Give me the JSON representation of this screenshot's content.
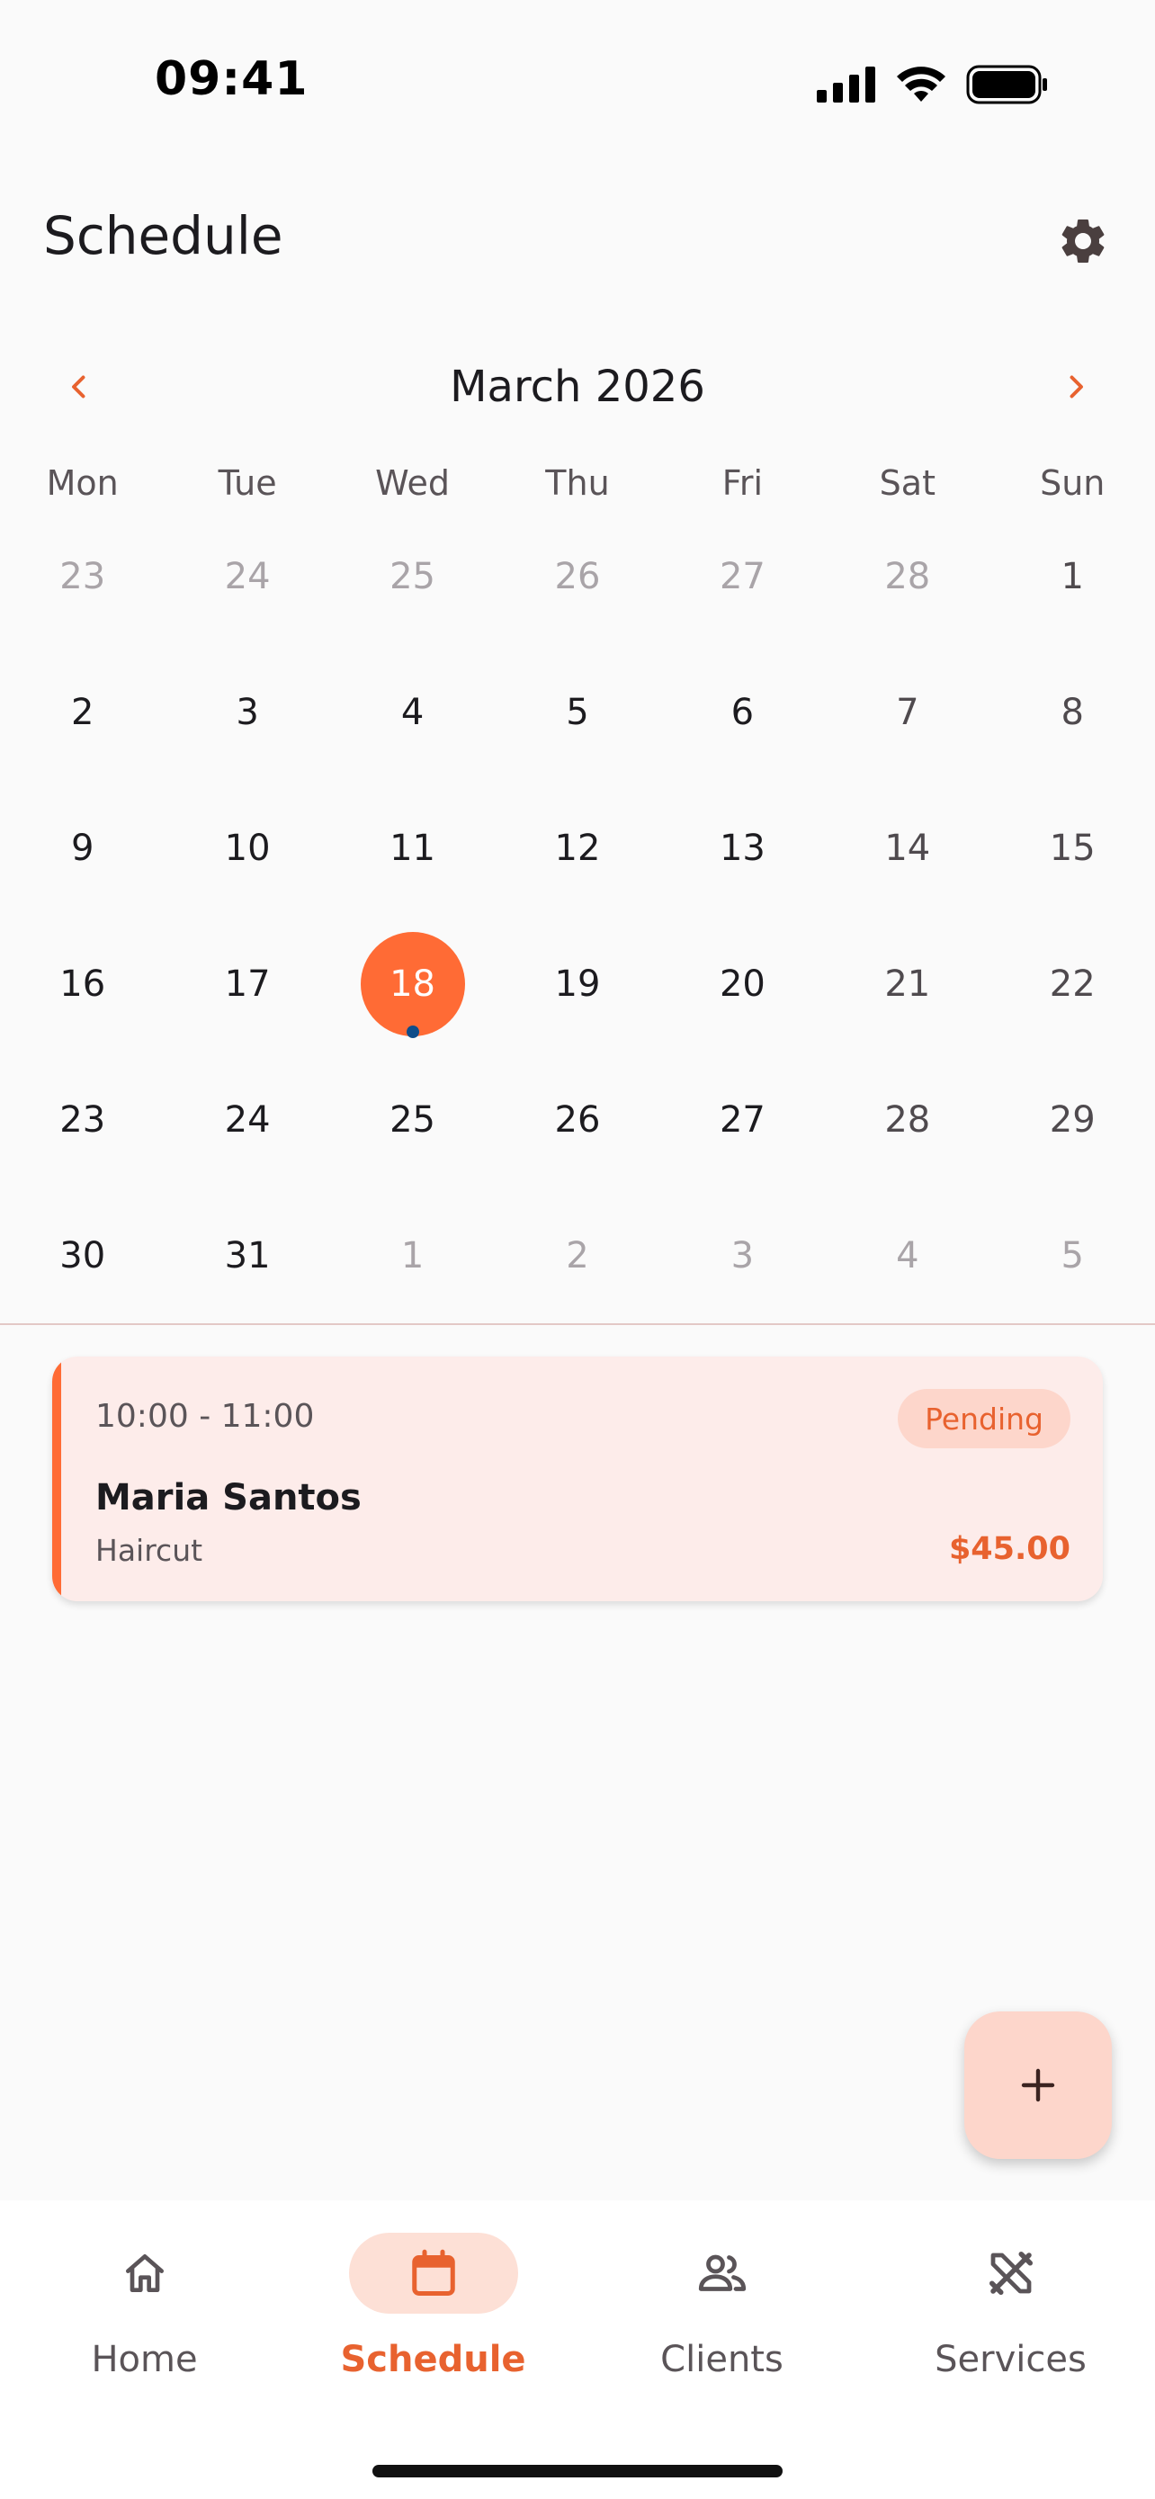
{
  "status_bar": {
    "time": "09:41"
  },
  "header": {
    "title": "Schedule",
    "settings_icon": "gear-icon"
  },
  "calendar": {
    "month_label": "March 2026",
    "weekdays": [
      "Mon",
      "Tue",
      "Wed",
      "Thu",
      "Fri",
      "Sat",
      "Sun"
    ],
    "weeks": [
      [
        "23",
        "24",
        "25",
        "26",
        "27",
        "28",
        "1"
      ],
      [
        "2",
        "3",
        "4",
        "5",
        "6",
        "7",
        "8"
      ],
      [
        "9",
        "10",
        "11",
        "12",
        "13",
        "14",
        "15"
      ],
      [
        "16",
        "17",
        "18",
        "19",
        "20",
        "21",
        "22"
      ],
      [
        "23",
        "24",
        "25",
        "26",
        "27",
        "28",
        "29"
      ],
      [
        "30",
        "31",
        "1",
        "2",
        "3",
        "4",
        "5"
      ]
    ],
    "selected_day": "18",
    "accent_color": "#ff6b35",
    "event_dot_color": "#0f4d8a"
  },
  "appointments": [
    {
      "time": "10:00 - 11:00",
      "status": "Pending",
      "client": "Maria Santos",
      "service": "Haircut",
      "price": "$45.00"
    }
  ],
  "fab": {
    "icon": "plus-icon"
  },
  "bottom_nav": {
    "items": [
      {
        "label": "Home",
        "icon": "home-icon",
        "active": false
      },
      {
        "label": "Schedule",
        "icon": "calendar-icon",
        "active": true
      },
      {
        "label": "Clients",
        "icon": "people-icon",
        "active": false
      },
      {
        "label": "Services",
        "icon": "tools-icon",
        "active": false
      }
    ]
  }
}
